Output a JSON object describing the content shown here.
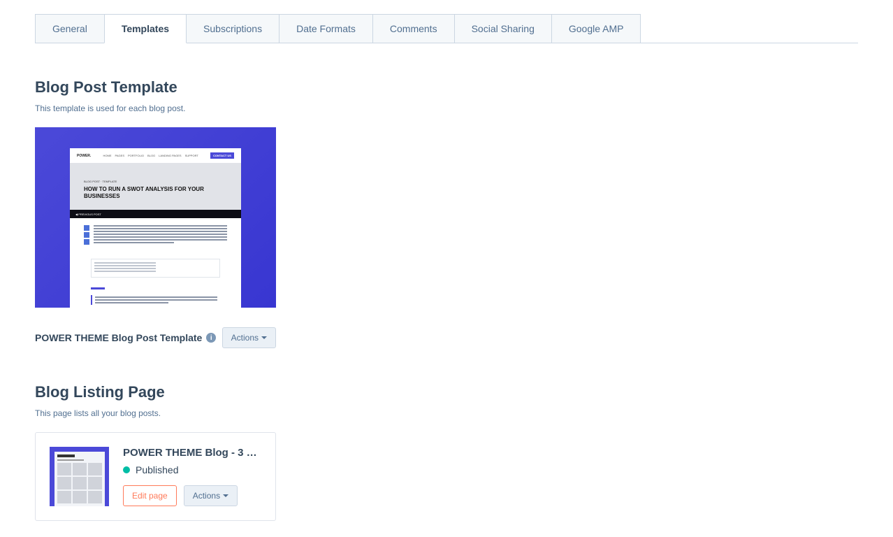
{
  "tabs": {
    "general": "General",
    "templates": "Templates",
    "subscriptions": "Subscriptions",
    "dateformats": "Date Formats",
    "comments": "Comments",
    "socialsharing": "Social Sharing",
    "googleamp": "Google AMP"
  },
  "blog_post": {
    "section_title": "Blog Post Template",
    "section_desc": "This template is used for each blog post.",
    "template_name": "POWER THEME Blog Post Template",
    "actions_label": "Actions",
    "preview": {
      "brand": "POWER.",
      "nav_items": [
        "HOME",
        "PAGES",
        "PORTFOLIO",
        "BLOG",
        "LANDING PAGES",
        "SUPPORT"
      ],
      "cta": "CONTACT US",
      "hero_bc": "BLOG POST · TEMPLATE",
      "hero_title": "HOW TO RUN A SWOT ANALYSIS FOR YOUR BUSINESSES",
      "blackbar_text": "◀   PREVIOUS POST"
    }
  },
  "blog_listing": {
    "section_title": "Blog Listing Page",
    "section_desc": "This page lists all your blog posts.",
    "page_title": "POWER THEME Blog - 3 …",
    "status": "Published",
    "edit_label": "Edit page",
    "actions_label": "Actions"
  }
}
